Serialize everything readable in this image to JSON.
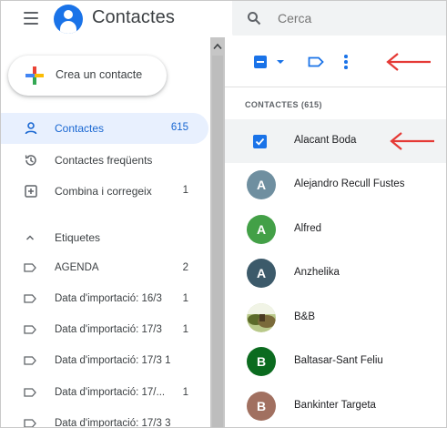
{
  "header": {
    "app_title": "Contactes",
    "search_placeholder": "Cerca"
  },
  "sidebar": {
    "create_label": "Crea un contacte",
    "items": [
      {
        "label": "Contactes",
        "count": "615",
        "icon": "person-icon",
        "active": true
      },
      {
        "label": "Contactes freqüents",
        "count": "",
        "icon": "history-icon",
        "active": false
      },
      {
        "label": "Combina i corregeix",
        "count": "1",
        "icon": "merge-icon",
        "active": false
      }
    ],
    "labels_header": "Etiquetes",
    "labels": [
      {
        "label": "AGENDA",
        "count": "2"
      },
      {
        "label": "Data d'importació: 16/3",
        "count": "1"
      },
      {
        "label": "Data d'importació: 17/3",
        "count": "1"
      },
      {
        "label": "Data d'importació: 17/3 1",
        "count": ""
      },
      {
        "label": "Data d'importació: 17/...",
        "count": "1"
      },
      {
        "label": "Data d'importació: 17/3 3",
        "count": ""
      }
    ]
  },
  "main": {
    "section_header": "CONTACTES (615)",
    "contacts": [
      {
        "name": "Alacant Boda",
        "initial": "",
        "color": "#1a73e8",
        "selected": true
      },
      {
        "name": "Alejandro Recull Fustes",
        "initial": "A",
        "color": "#6f8fa0",
        "selected": false
      },
      {
        "name": "Alfred",
        "initial": "A",
        "color": "#43a047",
        "selected": false
      },
      {
        "name": "Anzhelika",
        "initial": "A",
        "color": "#3c5a6a",
        "selected": false
      },
      {
        "name": "B&B",
        "initial": "",
        "color": "#6d7a3a",
        "selected": false
      },
      {
        "name": "Baltasar-Sant Feliu",
        "initial": "B",
        "color": "#0b6b1f",
        "selected": false
      },
      {
        "name": "Bankinter Targeta",
        "initial": "B",
        "color": "#a17060",
        "selected": false
      }
    ]
  },
  "colors": {
    "accent": "#1a73e8",
    "active_bg": "#e8f0fe",
    "annotation_arrow": "#e53935"
  }
}
